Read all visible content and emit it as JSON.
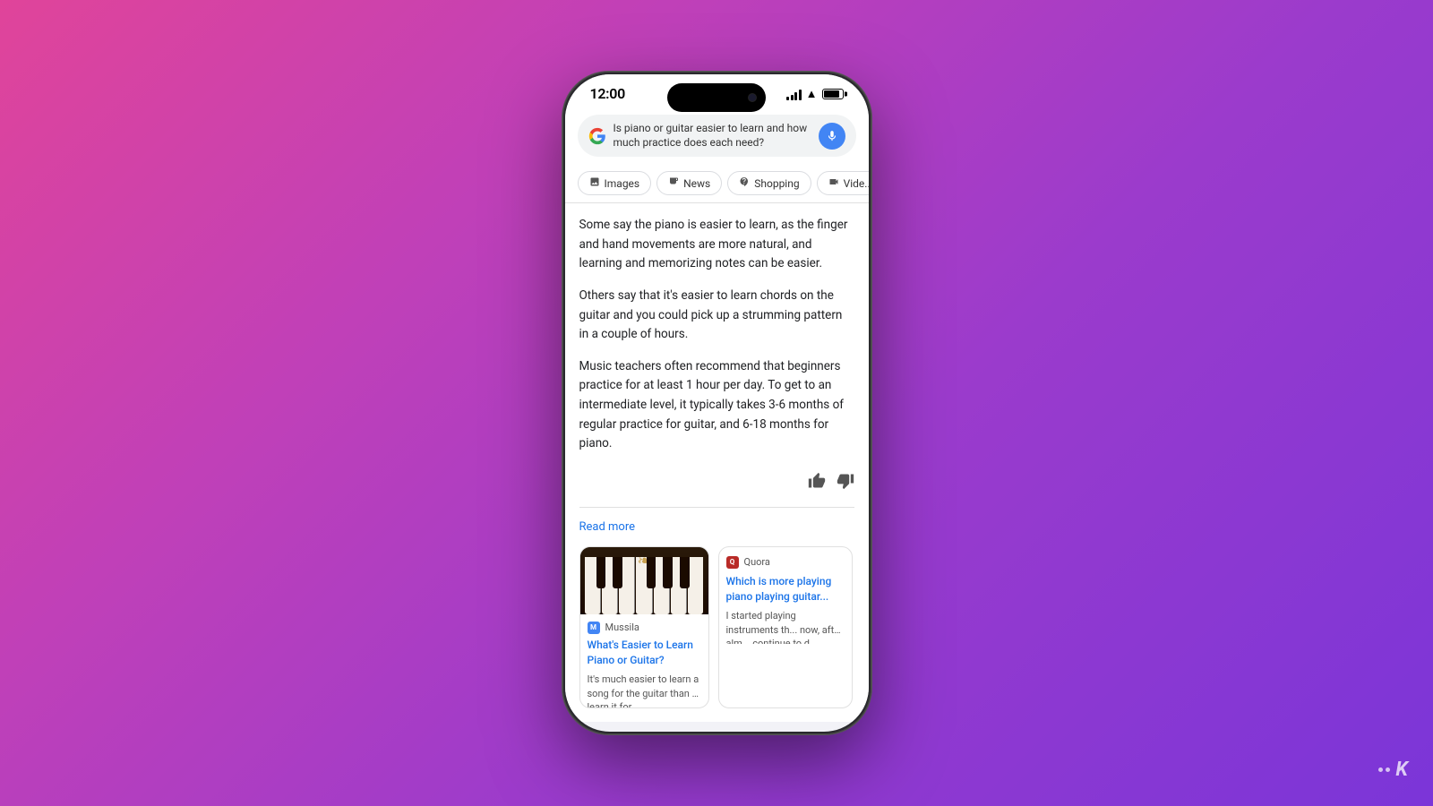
{
  "background": {
    "gradient": "linear-gradient(135deg, #e0449a 0%, #c040b8 30%, #9b3bcc 60%, #7b35d8 100%)"
  },
  "phone": {
    "status_bar": {
      "time": "12:00"
    },
    "search_bar": {
      "query": "Is piano or guitar easier to learn and how much practice does each need?",
      "mic_label": "🎤"
    },
    "filter_tabs": [
      {
        "icon": "🖼",
        "label": "Images"
      },
      {
        "icon": "📰",
        "label": "News"
      },
      {
        "icon": "🛍",
        "label": "Shopping"
      },
      {
        "icon": "▶",
        "label": "Vide..."
      }
    ],
    "answer": {
      "paragraph1": "Some say the piano is easier to learn, as the finger and hand movements are more natural, and learning and memorizing notes can be easier.",
      "paragraph2": "Others say that it's easier to learn chords on the guitar and you could pick up a strumming pattern in a couple of hours.",
      "paragraph3": "Music teachers often recommend that beginners practice for at least 1 hour per day. To get to an intermediate level, it typically takes 3-6 months of regular practice for guitar, and 6-18 months for piano.",
      "read_more": "Read more"
    },
    "cards": [
      {
        "source": "Mussila",
        "title": "What's Easier to Learn Piano or Guitar?",
        "snippet": "It's much easier to learn a song for the guitar than to learn it for",
        "favicon_color": "#4285f4",
        "favicon_letter": "M",
        "has_image": true
      },
      {
        "source": "Quora",
        "title": "Which is more playing piano playing guitar...",
        "snippet": "I started playing instruments th... now, after alm... continue to d... proficient...",
        "favicon_color": "#b92b27",
        "favicon_letter": "Q"
      }
    ],
    "watermark": {
      "k_letter": "K"
    }
  }
}
